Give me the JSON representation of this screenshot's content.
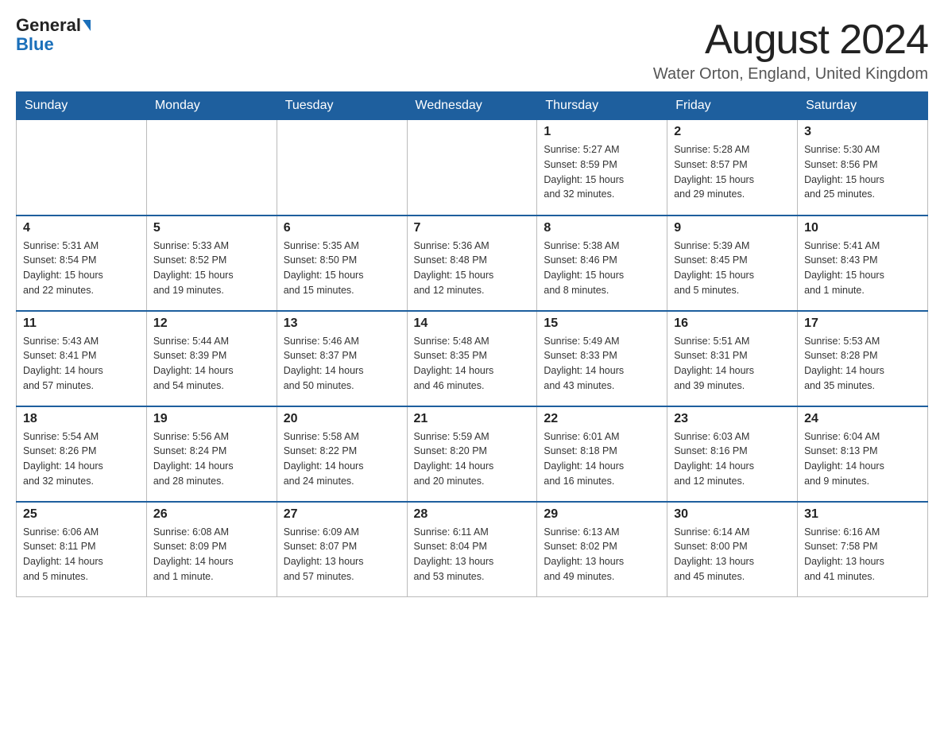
{
  "header": {
    "logo_text1": "General",
    "logo_text2": "Blue",
    "month_title": "August 2024",
    "location": "Water Orton, England, United Kingdom"
  },
  "weekdays": [
    "Sunday",
    "Monday",
    "Tuesday",
    "Wednesday",
    "Thursday",
    "Friday",
    "Saturday"
  ],
  "weeks": [
    [
      {
        "day": "",
        "info": ""
      },
      {
        "day": "",
        "info": ""
      },
      {
        "day": "",
        "info": ""
      },
      {
        "day": "",
        "info": ""
      },
      {
        "day": "1",
        "info": "Sunrise: 5:27 AM\nSunset: 8:59 PM\nDaylight: 15 hours\nand 32 minutes."
      },
      {
        "day": "2",
        "info": "Sunrise: 5:28 AM\nSunset: 8:57 PM\nDaylight: 15 hours\nand 29 minutes."
      },
      {
        "day": "3",
        "info": "Sunrise: 5:30 AM\nSunset: 8:56 PM\nDaylight: 15 hours\nand 25 minutes."
      }
    ],
    [
      {
        "day": "4",
        "info": "Sunrise: 5:31 AM\nSunset: 8:54 PM\nDaylight: 15 hours\nand 22 minutes."
      },
      {
        "day": "5",
        "info": "Sunrise: 5:33 AM\nSunset: 8:52 PM\nDaylight: 15 hours\nand 19 minutes."
      },
      {
        "day": "6",
        "info": "Sunrise: 5:35 AM\nSunset: 8:50 PM\nDaylight: 15 hours\nand 15 minutes."
      },
      {
        "day": "7",
        "info": "Sunrise: 5:36 AM\nSunset: 8:48 PM\nDaylight: 15 hours\nand 12 minutes."
      },
      {
        "day": "8",
        "info": "Sunrise: 5:38 AM\nSunset: 8:46 PM\nDaylight: 15 hours\nand 8 minutes."
      },
      {
        "day": "9",
        "info": "Sunrise: 5:39 AM\nSunset: 8:45 PM\nDaylight: 15 hours\nand 5 minutes."
      },
      {
        "day": "10",
        "info": "Sunrise: 5:41 AM\nSunset: 8:43 PM\nDaylight: 15 hours\nand 1 minute."
      }
    ],
    [
      {
        "day": "11",
        "info": "Sunrise: 5:43 AM\nSunset: 8:41 PM\nDaylight: 14 hours\nand 57 minutes."
      },
      {
        "day": "12",
        "info": "Sunrise: 5:44 AM\nSunset: 8:39 PM\nDaylight: 14 hours\nand 54 minutes."
      },
      {
        "day": "13",
        "info": "Sunrise: 5:46 AM\nSunset: 8:37 PM\nDaylight: 14 hours\nand 50 minutes."
      },
      {
        "day": "14",
        "info": "Sunrise: 5:48 AM\nSunset: 8:35 PM\nDaylight: 14 hours\nand 46 minutes."
      },
      {
        "day": "15",
        "info": "Sunrise: 5:49 AM\nSunset: 8:33 PM\nDaylight: 14 hours\nand 43 minutes."
      },
      {
        "day": "16",
        "info": "Sunrise: 5:51 AM\nSunset: 8:31 PM\nDaylight: 14 hours\nand 39 minutes."
      },
      {
        "day": "17",
        "info": "Sunrise: 5:53 AM\nSunset: 8:28 PM\nDaylight: 14 hours\nand 35 minutes."
      }
    ],
    [
      {
        "day": "18",
        "info": "Sunrise: 5:54 AM\nSunset: 8:26 PM\nDaylight: 14 hours\nand 32 minutes."
      },
      {
        "day": "19",
        "info": "Sunrise: 5:56 AM\nSunset: 8:24 PM\nDaylight: 14 hours\nand 28 minutes."
      },
      {
        "day": "20",
        "info": "Sunrise: 5:58 AM\nSunset: 8:22 PM\nDaylight: 14 hours\nand 24 minutes."
      },
      {
        "day": "21",
        "info": "Sunrise: 5:59 AM\nSunset: 8:20 PM\nDaylight: 14 hours\nand 20 minutes."
      },
      {
        "day": "22",
        "info": "Sunrise: 6:01 AM\nSunset: 8:18 PM\nDaylight: 14 hours\nand 16 minutes."
      },
      {
        "day": "23",
        "info": "Sunrise: 6:03 AM\nSunset: 8:16 PM\nDaylight: 14 hours\nand 12 minutes."
      },
      {
        "day": "24",
        "info": "Sunrise: 6:04 AM\nSunset: 8:13 PM\nDaylight: 14 hours\nand 9 minutes."
      }
    ],
    [
      {
        "day": "25",
        "info": "Sunrise: 6:06 AM\nSunset: 8:11 PM\nDaylight: 14 hours\nand 5 minutes."
      },
      {
        "day": "26",
        "info": "Sunrise: 6:08 AM\nSunset: 8:09 PM\nDaylight: 14 hours\nand 1 minute."
      },
      {
        "day": "27",
        "info": "Sunrise: 6:09 AM\nSunset: 8:07 PM\nDaylight: 13 hours\nand 57 minutes."
      },
      {
        "day": "28",
        "info": "Sunrise: 6:11 AM\nSunset: 8:04 PM\nDaylight: 13 hours\nand 53 minutes."
      },
      {
        "day": "29",
        "info": "Sunrise: 6:13 AM\nSunset: 8:02 PM\nDaylight: 13 hours\nand 49 minutes."
      },
      {
        "day": "30",
        "info": "Sunrise: 6:14 AM\nSunset: 8:00 PM\nDaylight: 13 hours\nand 45 minutes."
      },
      {
        "day": "31",
        "info": "Sunrise: 6:16 AM\nSunset: 7:58 PM\nDaylight: 13 hours\nand 41 minutes."
      }
    ]
  ]
}
